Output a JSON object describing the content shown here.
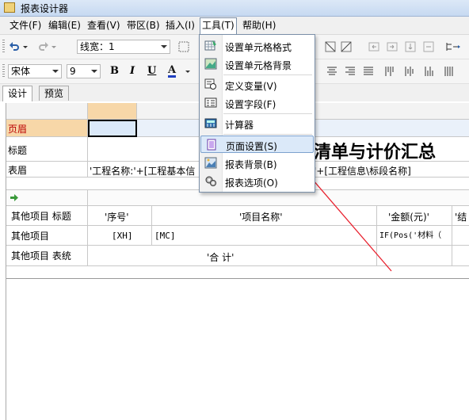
{
  "window": {
    "title": "报表设计器"
  },
  "menu": [
    "文件(F)",
    "编辑(E)",
    "查看(V)",
    "带区(B)",
    "插入(I)",
    "工具(T)",
    "帮助(H)"
  ],
  "toolbar1": {
    "line_width_label": "线宽：1"
  },
  "toolbar2": {
    "font_name": "宋体",
    "font_size": "9",
    "bold": "B",
    "italic": "I",
    "underline": "U",
    "font_color_glyph": "A"
  },
  "tabs": [
    "设计",
    "预览"
  ],
  "tools_menu": {
    "items": [
      {
        "label": "设置单元格格式",
        "icon": "cell-format-icon"
      },
      {
        "label": "设置单元格背景",
        "icon": "cell-background-icon"
      },
      {
        "label": "定义变量(V)",
        "icon": "variable-icon"
      },
      {
        "label": "设置字段(F)",
        "icon": "field-icon"
      },
      {
        "label": "计算器",
        "icon": "calculator-icon"
      },
      {
        "label": "页面设置(S)",
        "icon": "page-setup-icon"
      },
      {
        "label": "报表背景(B)",
        "icon": "report-background-icon"
      },
      {
        "label": "报表选项(O)",
        "icon": "report-options-icon"
      }
    ],
    "highlighted": "页面设置(S)"
  },
  "sheet": {
    "row_labels": {
      "page_header": "页眉",
      "title": "标题",
      "table_header": "表眉",
      "other_title": "其他项目 标题",
      "other": "其他项目",
      "other_footer": "其他项目 表统"
    },
    "title_text": "清单与计价汇总",
    "header_formula_1": "'工程名称:'+[工程基本信",
    "header_formula_2": "'+[工程信息\\标段名称]",
    "columns": [
      "'序号'",
      "'项目名称'",
      "'金额(元)'",
      "'结"
    ],
    "data_row": [
      "[XH]",
      "[MC]",
      "IF(Pos('材料（"
    ],
    "total_label": "'合    计'"
  },
  "colors": {
    "arrow": "#e8212e",
    "selected_cell": "#dbe9f9",
    "page_header_row": "#f7d7a8"
  }
}
